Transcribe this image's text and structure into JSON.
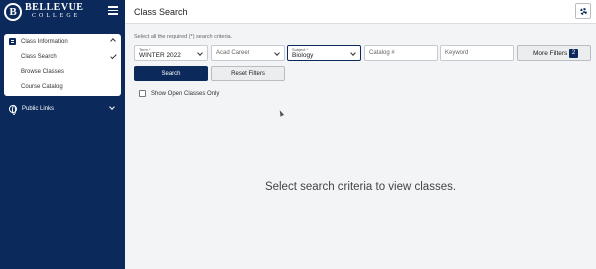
{
  "sidebar": {
    "logo_word": "BELLEVUE",
    "logo_sub": "COLLEGE",
    "logo_mark": "B",
    "menu_icon": "hamburger-icon",
    "sections": [
      {
        "label": "Class Information",
        "icon": "list-icon",
        "expanded": true,
        "items": [
          {
            "label": "Class Search",
            "selected": true
          },
          {
            "label": "Browse Classes",
            "selected": false
          },
          {
            "label": "Course Catalog",
            "selected": false
          }
        ]
      },
      {
        "label": "Public Links",
        "icon": "globe-icon",
        "expanded": false
      }
    ]
  },
  "header": {
    "title": "Class Search",
    "settings_icon": "gear-icon"
  },
  "main": {
    "hint": "Select all the required (*) search criteria.",
    "filters": {
      "term": {
        "label": "Term *",
        "value": "WINTER 2022"
      },
      "career": {
        "placeholder": "Acad Career"
      },
      "subject": {
        "label": "Subject *",
        "value": "Biology"
      },
      "catalog": {
        "placeholder": "Catalog #"
      },
      "keyword": {
        "placeholder": "Keyword"
      },
      "more_filters_label": "More Filters",
      "more_filters_count": "2"
    },
    "search_label": "Search",
    "reset_label": "Reset Filters",
    "open_only_label": "Show Open Classes Only",
    "open_only_checked": false,
    "empty_message": "Select search criteria to view classes."
  },
  "colors": {
    "brand": "#0b2a5b",
    "background": "#f3f4f6"
  }
}
